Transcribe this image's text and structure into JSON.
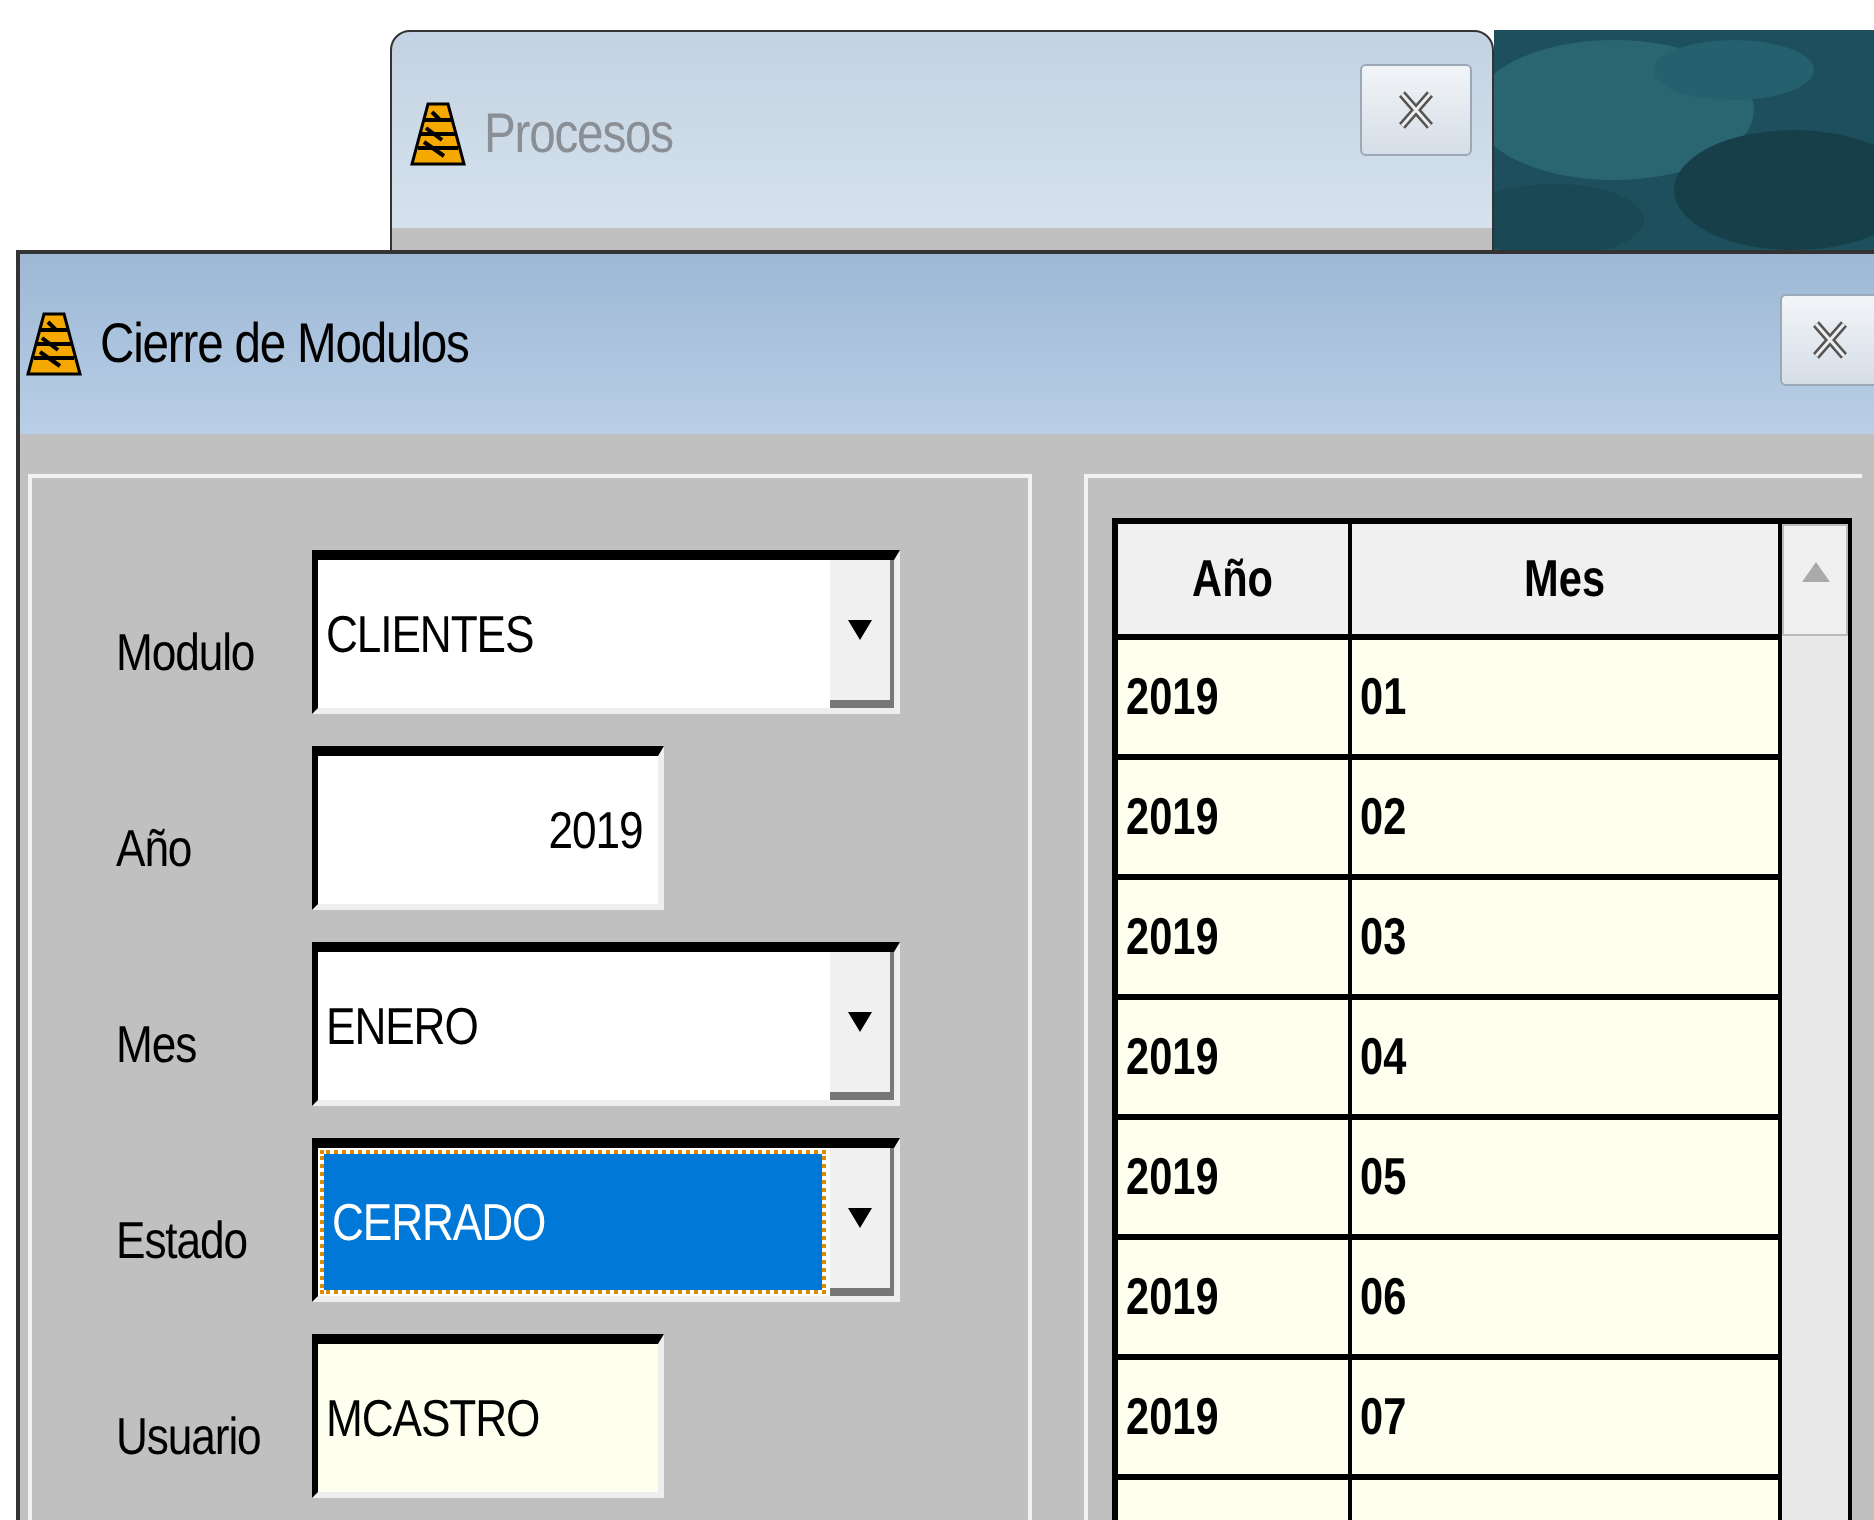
{
  "background_window": {
    "title": "Procesos"
  },
  "window": {
    "title": "Cierre de Modulos"
  },
  "form": {
    "fields": [
      {
        "label": "Modulo",
        "kind": "combo",
        "value": "CLIENTES",
        "focused": false
      },
      {
        "label": "Año",
        "kind": "number",
        "value": "2019",
        "focused": false
      },
      {
        "label": "Mes",
        "kind": "combo",
        "value": "ENERO",
        "focused": false
      },
      {
        "label": "Estado",
        "kind": "combo",
        "value": "CERRADO",
        "focused": true
      },
      {
        "label": "Usuario",
        "kind": "readonly",
        "value": "MCASTRO",
        "focused": false
      }
    ]
  },
  "table": {
    "columns": [
      "Año",
      "Mes"
    ],
    "rows": [
      {
        "cells": [
          "2019",
          "01"
        ]
      },
      {
        "cells": [
          "2019",
          "02"
        ]
      },
      {
        "cells": [
          "2019",
          "03"
        ]
      },
      {
        "cells": [
          "2019",
          "04"
        ]
      },
      {
        "cells": [
          "2019",
          "05"
        ]
      },
      {
        "cells": [
          "2019",
          "06"
        ]
      },
      {
        "cells": [
          "2019",
          "07"
        ]
      }
    ]
  }
}
